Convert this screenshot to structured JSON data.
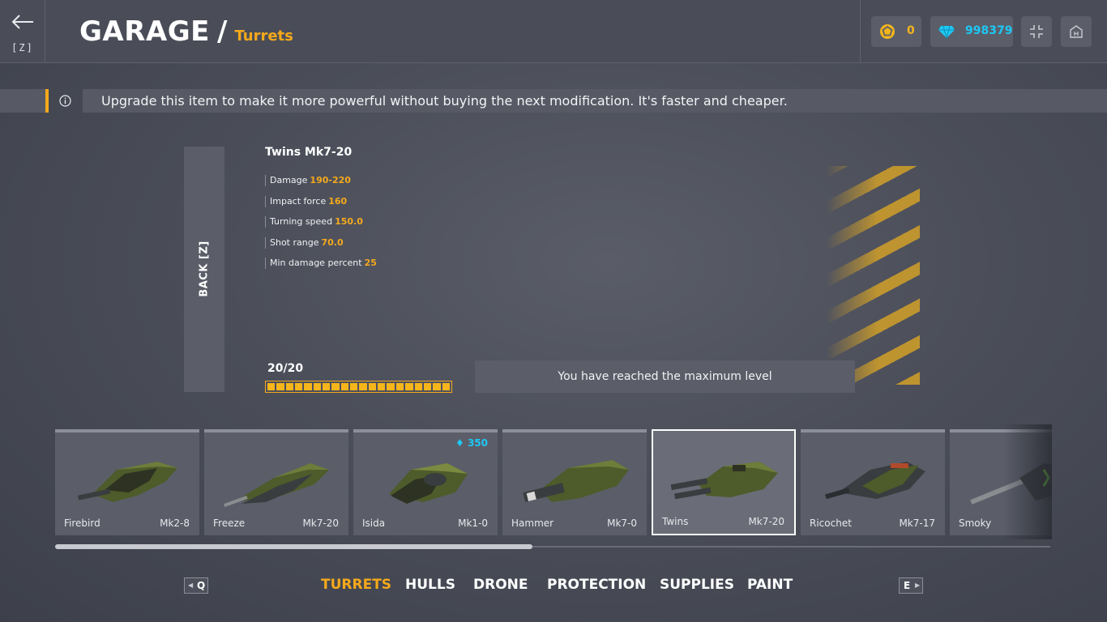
{
  "header": {
    "back_key": "[Z]",
    "title": "GARAGE",
    "slash": "/",
    "subtitle": "Turrets",
    "crystal_coins": "0",
    "crystals": "998379"
  },
  "banner": {
    "text": "Upgrade this item to make it more powerful without buying the next modification. It's faster and cheaper."
  },
  "back_panel": {
    "label": "BACK [Z]"
  },
  "item": {
    "name": "Twins Mk7-20",
    "stats": [
      {
        "label": "Damage",
        "value": "190-220"
      },
      {
        "label": "Impact force",
        "value": "160"
      },
      {
        "label": "Turning speed",
        "value": "150.0"
      },
      {
        "label": "Shot range",
        "value": "70.0"
      },
      {
        "label": "Min damage percent",
        "value": "25"
      }
    ]
  },
  "progress": {
    "label": "20/20",
    "current": 20,
    "max": 20
  },
  "max_level_text": "You have reached the maximum level",
  "cards": [
    {
      "name": "Firebird",
      "mod": "Mk2-8",
      "price": ""
    },
    {
      "name": "Freeze",
      "mod": "Mk7-20",
      "price": ""
    },
    {
      "name": "Isida",
      "mod": "Mk1-0",
      "price": "350"
    },
    {
      "name": "Hammer",
      "mod": "Mk7-0",
      "price": ""
    },
    {
      "name": "Twins",
      "mod": "Mk7-20",
      "price": ""
    },
    {
      "name": "Ricochet",
      "mod": "Mk7-17",
      "price": ""
    },
    {
      "name": "Smoky",
      "mod": "",
      "price": ""
    }
  ],
  "scroll": {
    "fraction": 0.48
  },
  "nav": {
    "prev_key": "Q",
    "next_key": "E",
    "tabs": [
      "TURRETS",
      "HULLS",
      "DRONE",
      "PROTECTION",
      "SUPPLIES",
      "PAINT"
    ],
    "active": "TURRETS"
  },
  "colors": {
    "accent": "#f5a91b",
    "crystal": "#1ec8f5",
    "turret_green": "#4e5b2a"
  }
}
